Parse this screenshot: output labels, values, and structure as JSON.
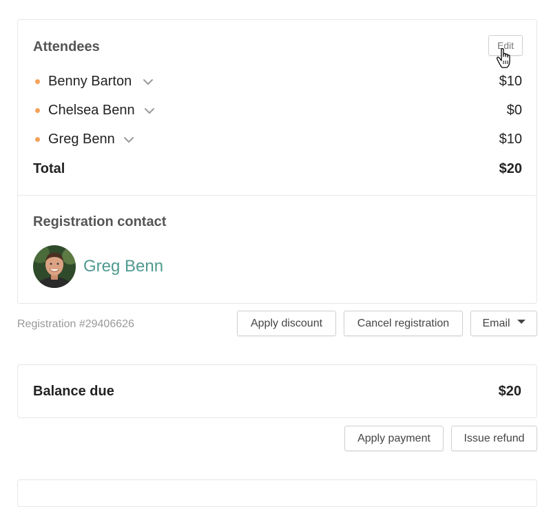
{
  "attendees": {
    "title": "Attendees",
    "edit_label": "Edit",
    "rows": [
      {
        "name": "Benny Barton",
        "amount": "$10"
      },
      {
        "name": "Chelsea Benn",
        "amount": "$0"
      },
      {
        "name": "Greg Benn",
        "amount": "$10"
      }
    ],
    "total_label": "Total",
    "total_value": "$20"
  },
  "contact": {
    "title": "Registration contact",
    "name": "Greg Benn"
  },
  "registration": {
    "number": "Registration #29406626",
    "apply_discount_label": "Apply discount",
    "cancel_label": "Cancel registration",
    "email_label": "Email"
  },
  "balance": {
    "label": "Balance due",
    "value": "$20",
    "apply_payment_label": "Apply payment",
    "issue_refund_label": "Issue refund"
  },
  "colors": {
    "accent_link": "#4f9a8f",
    "bullet": "#f5a25a"
  },
  "icons": {
    "chevron": "chevron-down-icon",
    "cursor": "hand-pointer-icon",
    "caret": "caret-down-icon"
  }
}
